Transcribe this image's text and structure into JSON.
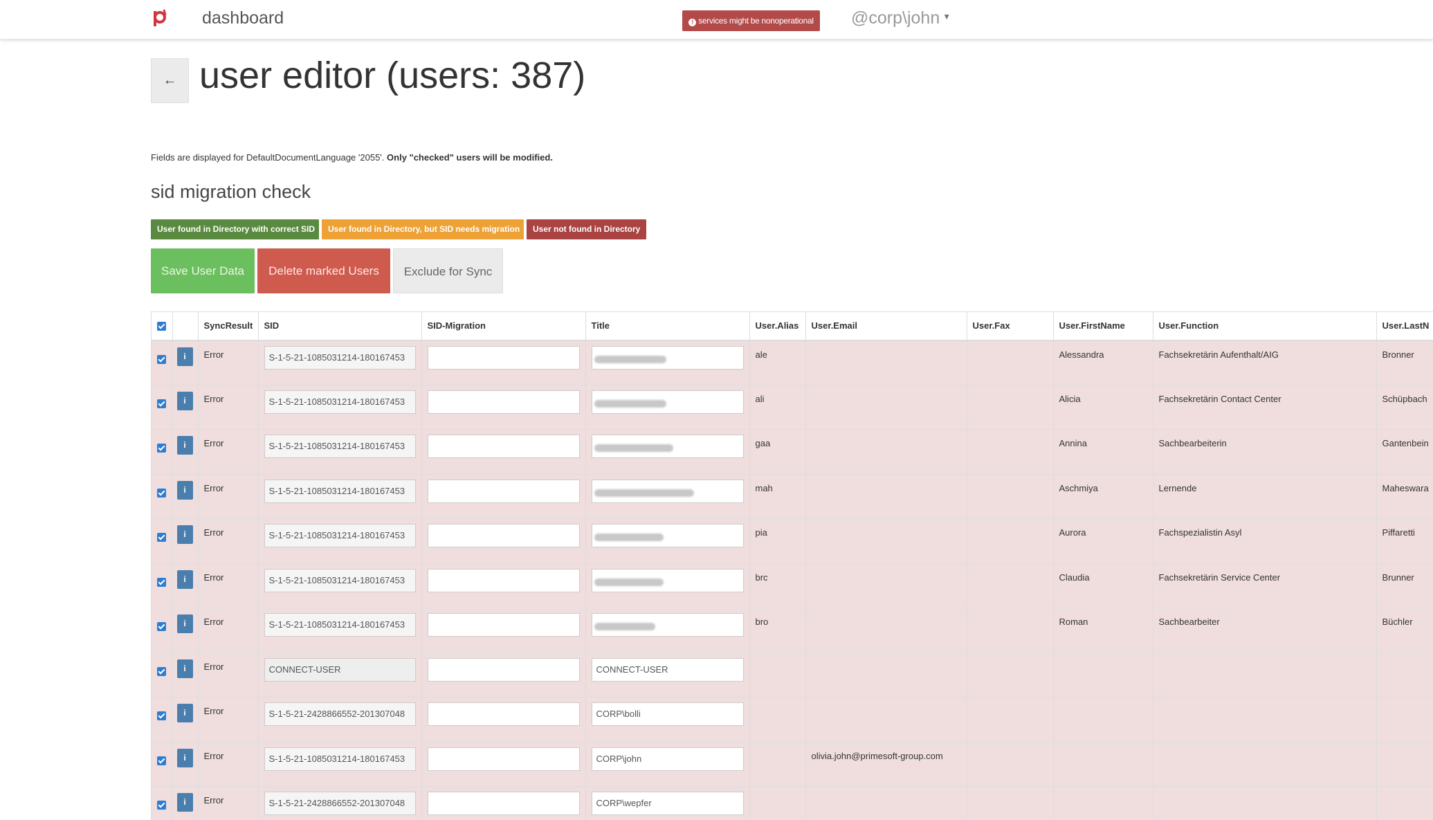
{
  "nav": {
    "brand": "dashboard",
    "warning_badge": "services might be nonoperational",
    "user": "@corp\\john"
  },
  "header": {
    "back_label": "←",
    "title": "user editor (users: 387)"
  },
  "info_text": "Fields are displayed for DefaultDocumentLanguage '2055'.",
  "info_bold": "Only \"checked\" users will be modified.",
  "section_title": "sid migration check",
  "legend": {
    "found_correct": "User found in Directory with correct SID",
    "needs_migration": "User found in Directory, but SID needs migration",
    "not_found": "User not found in Directory"
  },
  "actions": {
    "save": "Save User Data",
    "delete": "Delete marked Users",
    "exclude": "Exclude for Sync"
  },
  "colors": {
    "row_error_bg": "#f0dede",
    "legend_green": "#5a8a3f",
    "legend_orange": "#eea236",
    "legend_red": "#a94442",
    "save_btn": "#6cbf5e",
    "delete_btn": "#cf5b4e",
    "checkbox": "#2d7dd2",
    "info_btn": "#4a7ead"
  },
  "table": {
    "columns": [
      "SyncResult",
      "SID",
      "SID-Migration",
      "Title",
      "User.Alias",
      "User.Email",
      "User.Fax",
      "User.FirstName",
      "User.Function",
      "User.LastN"
    ],
    "info_label": "i",
    "rows": [
      {
        "sync": "Error",
        "sid": "S-1-5-21-1085031214-180167453",
        "migration": "",
        "title": "",
        "alias": "ale",
        "email": "",
        "fax": "",
        "first": "Alessandra",
        "function": "Fachsekretärin Aufenthalt/AIG",
        "last": "Bronner"
      },
      {
        "sync": "Error",
        "sid": "S-1-5-21-1085031214-180167453",
        "migration": "",
        "title": "",
        "alias": "ali",
        "email": "",
        "fax": "",
        "first": "Alicia",
        "function": "Fachsekretärin Contact Center",
        "last": "Schüpbach"
      },
      {
        "sync": "Error",
        "sid": "S-1-5-21-1085031214-180167453",
        "migration": "",
        "title": "",
        "alias": "gaa",
        "email": "",
        "fax": "",
        "first": "Annina",
        "function": "Sachbearbeiterin",
        "last": "Gantenbein"
      },
      {
        "sync": "Error",
        "sid": "S-1-5-21-1085031214-180167453",
        "migration": "",
        "title": "",
        "alias": "mah",
        "email": "",
        "fax": "",
        "first": "Aschmiya",
        "function": "Lernende",
        "last": "Maheswara"
      },
      {
        "sync": "Error",
        "sid": "S-1-5-21-1085031214-180167453",
        "migration": "",
        "title": "",
        "alias": "pia",
        "email": "",
        "fax": "",
        "first": "Aurora",
        "function": "Fachspezialistin Asyl",
        "last": "Piffaretti"
      },
      {
        "sync": "Error",
        "sid": "S-1-5-21-1085031214-180167453",
        "migration": "",
        "title": "",
        "alias": "brc",
        "email": "",
        "fax": "",
        "first": "Claudia",
        "function": "Fachsekretärin Service Center",
        "last": "Brunner"
      },
      {
        "sync": "Error",
        "sid": "S-1-5-21-1085031214-180167453",
        "migration": "",
        "title": "",
        "alias": "bro",
        "email": "",
        "fax": "",
        "first": "Roman",
        "function": "Sachbearbeiter",
        "last": "Büchler"
      },
      {
        "sync": "Error",
        "sid": "CONNECT-USER",
        "migration": "",
        "title": "CONNECT-USER",
        "alias": "",
        "email": "",
        "fax": "",
        "first": "",
        "function": "",
        "last": ""
      },
      {
        "sync": "Error",
        "sid": "S-1-5-21-2428866552-201307048",
        "migration": "",
        "title": "CORP\\bolli",
        "alias": "",
        "email": "",
        "fax": "",
        "first": "",
        "function": "",
        "last": ""
      },
      {
        "sync": "Error",
        "sid": "S-1-5-21-1085031214-180167453",
        "migration": "",
        "title": "CORP\\john",
        "alias": "",
        "email": "olivia.john@primesoft-group.com",
        "fax": "",
        "first": "",
        "function": "",
        "last": ""
      },
      {
        "sync": "Error",
        "sid": "S-1-5-21-2428866552-201307048",
        "migration": "",
        "title": "CORP\\wepfer",
        "alias": "",
        "email": "",
        "fax": "",
        "first": "",
        "function": "",
        "last": ""
      }
    ]
  }
}
